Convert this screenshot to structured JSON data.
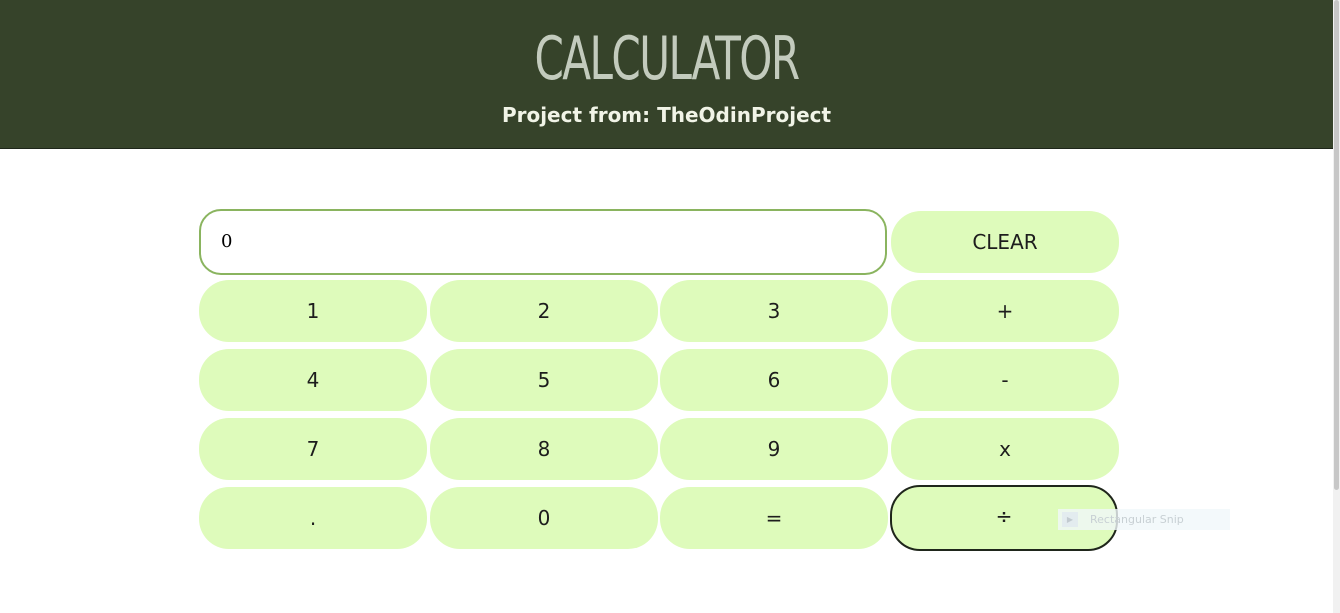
{
  "header": {
    "title": "CALCULATOR",
    "subtitle": "Project from: TheOdinProject"
  },
  "display": {
    "value": "0"
  },
  "buttons": {
    "clear": "CLEAR",
    "one": "1",
    "two": "2",
    "three": "3",
    "plus": "+",
    "four": "4",
    "five": "5",
    "six": "6",
    "minus": "-",
    "seven": "7",
    "eight": "8",
    "nine": "9",
    "multiply": "x",
    "decimal": ".",
    "zero": "0",
    "equals": "=",
    "divide": "÷"
  },
  "overlay": {
    "snip_label": "Rectangular Snip",
    "snip_icon": "play-icon"
  },
  "colors": {
    "header_bg": "#36432a",
    "button_bg": "#defbbb",
    "display_border": "#8ab45f"
  }
}
